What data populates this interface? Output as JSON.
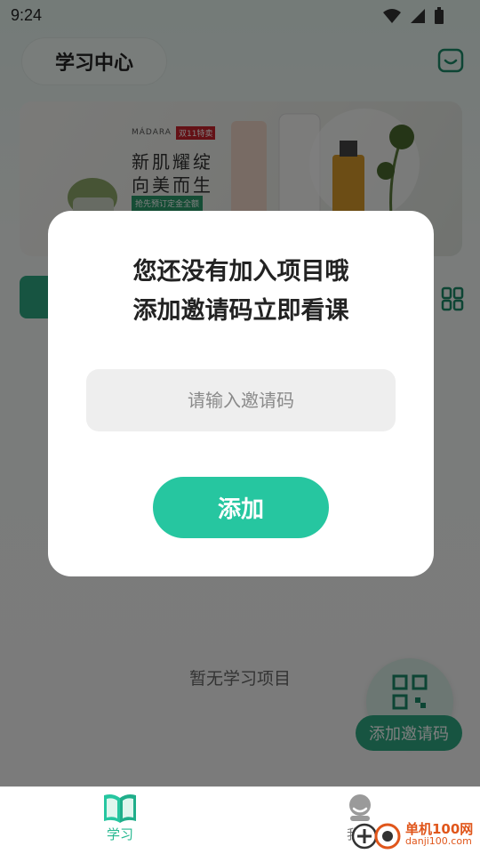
{
  "status_bar": {
    "time": "9:24"
  },
  "header": {
    "title": "学习中心",
    "message_icon": "message-icon"
  },
  "banner": {
    "brand": "MÁDARA",
    "tag": "双11特卖",
    "line1": "新肌耀绽",
    "line2": "向美而生",
    "sub": "抢先预订定金全额"
  },
  "empty_state": {
    "text": "暂无学习项目"
  },
  "fab": {
    "icon": "qr-code-icon",
    "label": "添加邀请码"
  },
  "dialog": {
    "title_line1": "您还没有加入项目哦",
    "title_line2": "添加邀请码立即看课",
    "input_placeholder": "请输入邀请码",
    "input_value": "",
    "add_button": "添加"
  },
  "bottom_nav": {
    "items": [
      {
        "label": "学习",
        "icon": "book-icon",
        "active": true
      },
      {
        "label": "我的",
        "icon": "person-icon",
        "active": false
      }
    ]
  },
  "watermark": {
    "name": "单机100网",
    "url": "danji100.com"
  },
  "colors": {
    "accent": "#26c6a0",
    "dark_accent": "#2fa882",
    "watermark": "#e0561b"
  }
}
